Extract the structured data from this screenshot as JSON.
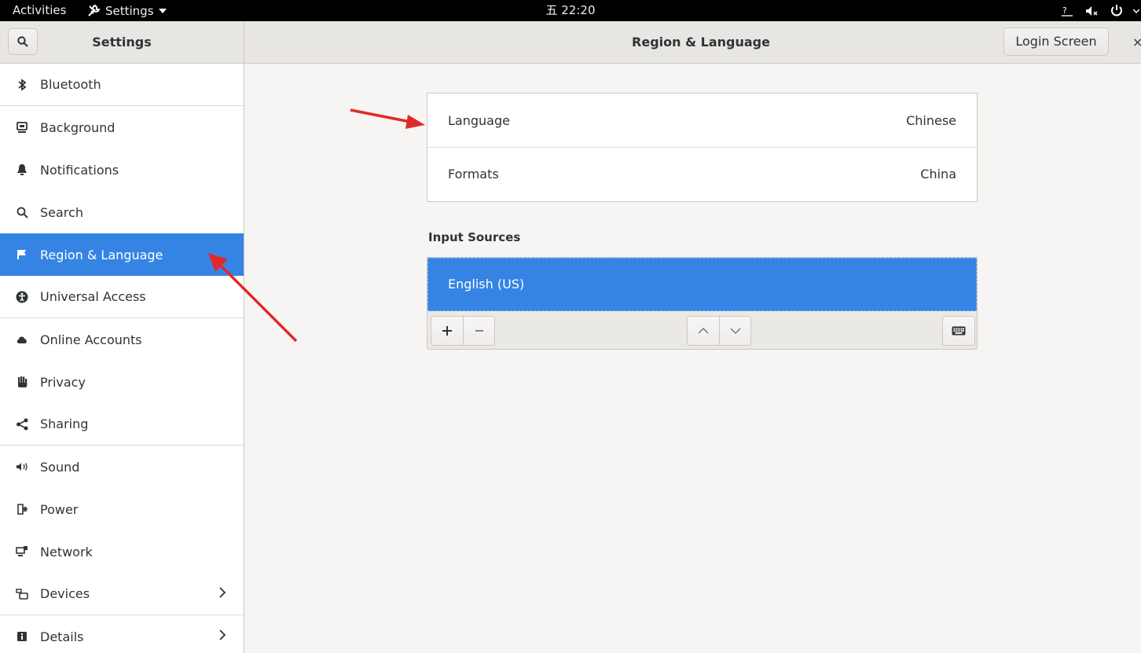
{
  "topbar": {
    "activities": "Activities",
    "app_menu": "Settings",
    "clock": "五 22:20"
  },
  "header": {
    "sidebar_title": "Settings",
    "title": "Region & Language",
    "login_button": "Login Screen",
    "close": "×"
  },
  "sidebar": {
    "items": [
      {
        "label": "Bluetooth",
        "icon": "bluetooth-icon"
      },
      {
        "label": "Background",
        "icon": "background-icon"
      },
      {
        "label": "Notifications",
        "icon": "bell-icon"
      },
      {
        "label": "Search",
        "icon": "search-icon"
      },
      {
        "label": "Region & Language",
        "icon": "flag-icon",
        "active": true
      },
      {
        "label": "Universal Access",
        "icon": "accessibility-icon"
      },
      {
        "label": "Online Accounts",
        "icon": "cloud-icon"
      },
      {
        "label": "Privacy",
        "icon": "hand-icon"
      },
      {
        "label": "Sharing",
        "icon": "share-icon"
      },
      {
        "label": "Sound",
        "icon": "speaker-icon"
      },
      {
        "label": "Power",
        "icon": "power-plug-icon"
      },
      {
        "label": "Network",
        "icon": "network-icon"
      },
      {
        "label": "Devices",
        "icon": "devices-icon",
        "chevron": true
      },
      {
        "label": "Details",
        "icon": "info-icon",
        "chevron": true
      }
    ]
  },
  "region": {
    "language_label": "Language",
    "language_value": "Chinese",
    "formats_label": "Formats",
    "formats_value": "China",
    "input_sources_heading": "Input Sources",
    "input_sources": [
      "English (US)"
    ]
  },
  "colors": {
    "accent": "#3584e4",
    "annotation_arrow": "#e02a2a"
  }
}
